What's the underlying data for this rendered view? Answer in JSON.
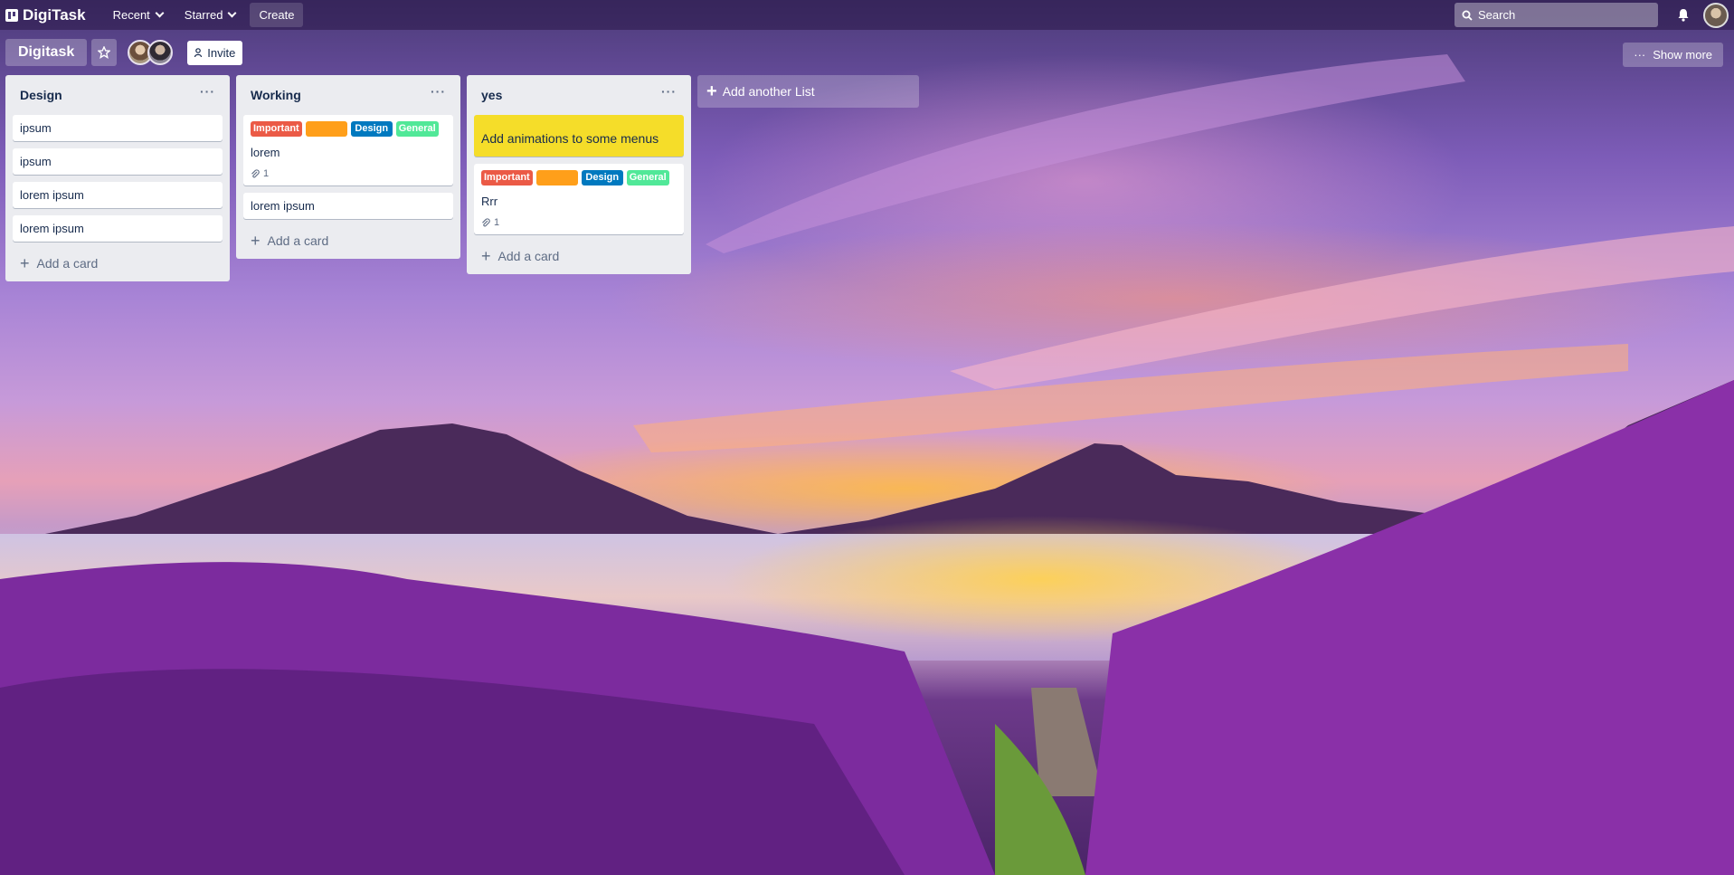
{
  "app": {
    "name": "DigiTask",
    "nav": {
      "recent": "Recent",
      "starred": "Starred",
      "create": "Create"
    },
    "search_placeholder": "Search"
  },
  "board": {
    "title": "Digitask",
    "invite": "Invite",
    "show_more": "Show more"
  },
  "lists": [
    {
      "title": "Design",
      "cards": [
        {
          "text": "ipsum"
        },
        {
          "text": "ipsum"
        },
        {
          "text": "lorem ipsum"
        },
        {
          "text": "lorem ipsum"
        }
      ],
      "add_card": "Add a card"
    },
    {
      "title": "Working",
      "cards": [
        {
          "text": "lorem",
          "labels": [
            "Important",
            "",
            "Design",
            "General"
          ],
          "attachments": "1"
        },
        {
          "text": "lorem ipsum"
        }
      ],
      "add_card": "Add a card"
    },
    {
      "title": "yes",
      "cards": [
        {
          "text": "Add animations to some menus",
          "color": "#f5dd29"
        },
        {
          "text": "Rrr",
          "labels": [
            "Important",
            "",
            "Design",
            "General"
          ],
          "attachments": "1"
        }
      ],
      "add_card": "Add a card"
    }
  ],
  "add_list": "Add another List",
  "label_colors": {
    "Important": "#eb5a46",
    "orange": "#ff9f1a",
    "Design": "#0079bf",
    "General": "#51e898"
  }
}
